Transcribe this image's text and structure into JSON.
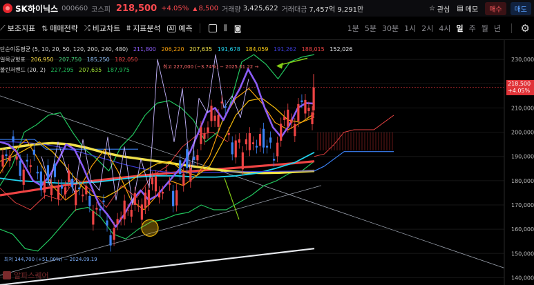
{
  "header": {
    "stock_name": "SK하이닉스",
    "code": "000660",
    "market": "코스피",
    "price": "218,500",
    "change_pct": "+4.05%",
    "change_arrow": "▲",
    "change_amount": "8,500",
    "volume_label": "거래량",
    "volume": "3,425,622",
    "value_label": "거래대금",
    "value": "7,457억 9,291만",
    "watch_label": "관심",
    "memo_label": "메모",
    "buy_label": "매수",
    "sell_label": "매도"
  },
  "toolbar": {
    "aux_indicator": "보조지표",
    "trade_strategy": "매매전략",
    "compare_chart": "비교차트",
    "indicator_analysis": "지표분석",
    "ai_badge": "AI",
    "ai_forecast": "예측",
    "periods": [
      "1분",
      "5분",
      "30분",
      "1시",
      "2시",
      "4시",
      "일",
      "주",
      "월",
      "년"
    ],
    "active_period": "일"
  },
  "legend": {
    "ma": {
      "label": "단순이동평균 (5, 10, 20, 50, 120, 200, 240, 480)",
      "values": [
        {
          "v": "211,800",
          "color": "#8b5cf6"
        },
        {
          "v": "206,220",
          "color": "#f59e0b"
        },
        {
          "v": "207,635",
          "color": "#f0e14a"
        },
        {
          "v": "191,678",
          "color": "#22d3ee"
        },
        {
          "v": "184,059",
          "color": "#facc15"
        },
        {
          "v": "191,262",
          "color": "#3b3bd6"
        },
        {
          "v": "188,015",
          "color": "#ef4444"
        },
        {
          "v": "152,026",
          "color": "#e5e7eb"
        }
      ]
    },
    "ichimoku": {
      "label": "일목균형표",
      "values": [
        {
          "v": "206,950",
          "color": "#fde047"
        },
        {
          "v": "207,750",
          "color": "#4ade80"
        },
        {
          "v": "185,250",
          "color": "#93c5fd"
        },
        {
          "v": "182,050",
          "color": "#ef4444"
        }
      ]
    },
    "bollinger": {
      "label": "볼린저밴드 (20, 2)",
      "values": [
        {
          "v": "227,295",
          "color": "#22c55e"
        },
        {
          "v": "207,635",
          "color": "#a3e635"
        },
        {
          "v": "187,975",
          "color": "#22c55e"
        }
      ]
    }
  },
  "annotations": {
    "high": "최고 227,000 (−3.74%) − 2025.01.22 →",
    "low": "최저 144,700 (+51.00%) − 2024.09.19"
  },
  "current_price_tag": {
    "price": "218,500",
    "pct": "+4.05%"
  },
  "watermark": "알파스퀘어",
  "colors": {
    "up": "#ff4a4f",
    "down": "#4a90ff",
    "buy": "#ff5a5f",
    "sell": "#5aa0ff"
  },
  "chart_data": {
    "type": "line",
    "y_ticks": [
      230000,
      220000,
      210000,
      200000,
      190000,
      180000,
      170000,
      160000,
      150000,
      140000
    ],
    "ylim": [
      137000,
      238000
    ],
    "ma5_close": [
      196000,
      195000,
      192000,
      186000,
      180000,
      178000,
      182000,
      188000,
      195000,
      193000,
      186000,
      178000,
      170000,
      166000,
      161000,
      166000,
      172000,
      176000,
      172000,
      174000,
      178000,
      182000,
      186000,
      192000,
      200000,
      208000,
      210000,
      205000,
      212000,
      218000,
      226000,
      220000,
      210000,
      202000,
      198000,
      203000,
      210000,
      212000,
      211800
    ],
    "ma200": [
      196000,
      196000,
      195800,
      195400,
      194800,
      194000,
      192900,
      191600,
      190300,
      189000,
      187600,
      186300,
      185200,
      184300,
      183700,
      183400,
      183300,
      183300,
      183400,
      183500,
      183600,
      183700,
      183800,
      183800,
      183900,
      183950,
      184000,
      184059
    ],
    "ma240": [
      174000,
      175000,
      176000,
      177000,
      178000,
      179000,
      180000,
      180700,
      181400,
      182100,
      182700,
      183300,
      183800,
      184300,
      184800,
      185300,
      185800,
      186300,
      186800,
      187400,
      188015
    ],
    "ma480": [
      137000,
      138500,
      140000,
      141500,
      143000,
      144500,
      146000,
      147500,
      149000,
      150500,
      152026
    ]
  }
}
